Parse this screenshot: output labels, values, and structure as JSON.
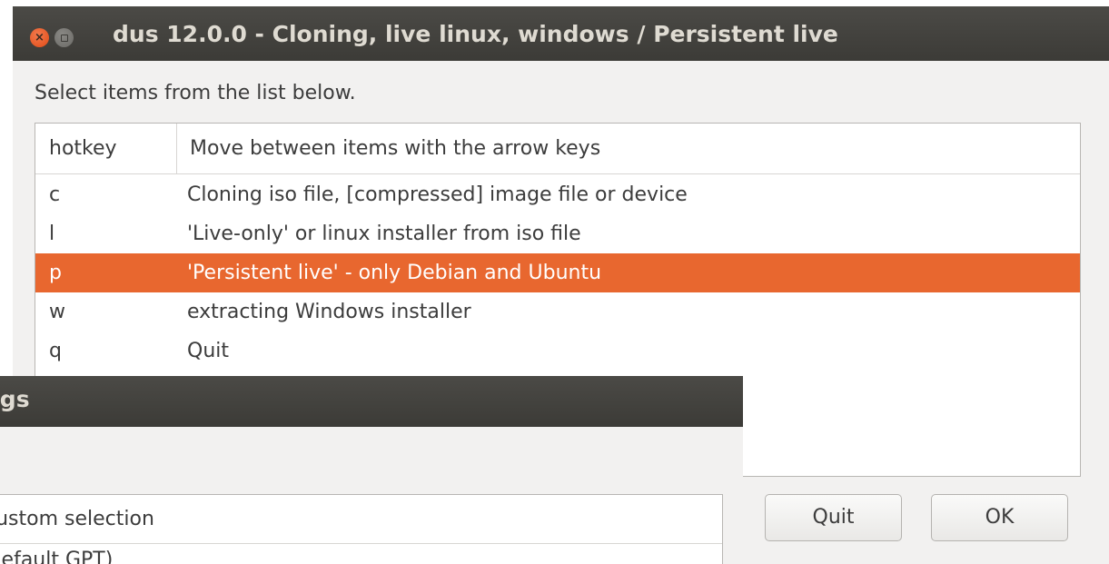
{
  "top_link_fragment": "",
  "main_window": {
    "title": "dus 12.0.0 - Cloning, live linux, windows / Persistent live",
    "close_glyph": "×",
    "instructions": "Select items from the list below.",
    "columns": [
      "hotkey",
      "Move between items with the arrow keys"
    ],
    "rows": [
      {
        "key": "c",
        "desc": "Cloning iso file, [compressed] image file or device"
      },
      {
        "key": "l",
        "desc": "'Live-only' or linux installer from iso file"
      },
      {
        "key": "p",
        "desc": "'Persistent live' - only Debian and Ubuntu"
      },
      {
        "key": "w",
        "desc": "extracting Windows installer"
      },
      {
        "key": "q",
        "desc": "Quit"
      }
    ],
    "selected_row": "p",
    "buttons": {
      "quit": "Quit",
      "ok": "OK"
    },
    "accent_color": "#e8672f"
  },
  "second_window": {
    "title_fragment": "ngs",
    "item1": "custom selection",
    "item2_fragment": "(default GPT)"
  }
}
